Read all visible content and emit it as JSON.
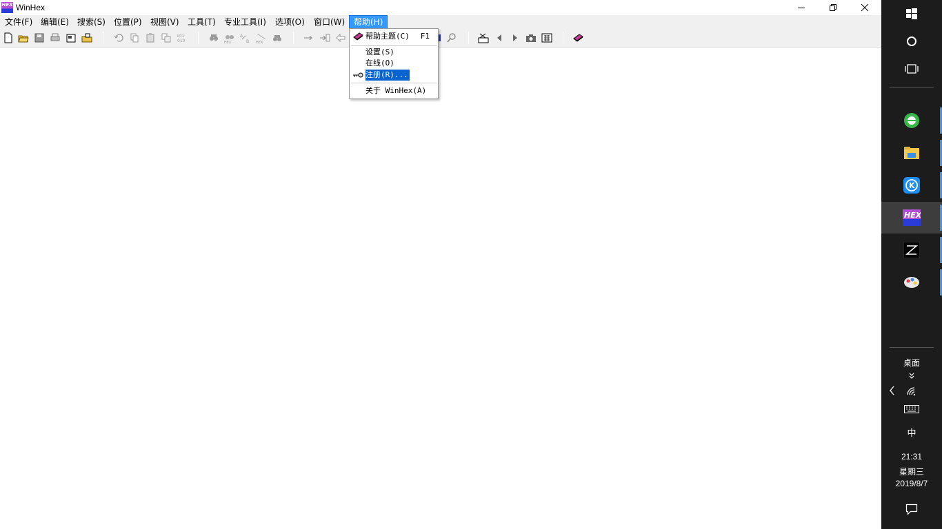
{
  "window": {
    "title": "WinHex",
    "app_icon_text": "HEX"
  },
  "menubar": {
    "items": [
      {
        "label": "文件(F)"
      },
      {
        "label": "编辑(E)"
      },
      {
        "label": "搜索(S)"
      },
      {
        "label": "位置(P)"
      },
      {
        "label": "视图(V)"
      },
      {
        "label": "工具(T)"
      },
      {
        "label": "专业工具(I)"
      },
      {
        "label": "选项(O)"
      },
      {
        "label": "窗口(W)"
      },
      {
        "label": "帮助(H)"
      }
    ],
    "active": "帮助(H)"
  },
  "help_menu": {
    "items": [
      {
        "label": "帮助主题(C)",
        "accelerator": "F1",
        "icon": "book-icon"
      },
      {
        "label": "设置(S)"
      },
      {
        "label": "在线(O)"
      },
      {
        "label": "注册(R)...",
        "icon": "key-icon",
        "highlighted": true
      },
      {
        "label": "关于 WinHex(A)"
      }
    ]
  },
  "taskbar": {
    "apps": [
      {
        "name": "browser-app-icon"
      },
      {
        "name": "file-explorer-icon"
      },
      {
        "name": "kugou-icon"
      },
      {
        "name": "winhex-taskbar-icon",
        "text": "HEX"
      },
      {
        "name": "z-app-icon"
      },
      {
        "name": "paint-app-icon"
      }
    ],
    "desktop_label": "桌面",
    "ime_label": "中",
    "time": "21:31",
    "weekday": "星期三",
    "date": "2019/8/7"
  },
  "colors": {
    "menu_highlight": "#3399ff",
    "selection": "#0a64d0",
    "taskbar_bg": "#1c1c1c"
  }
}
